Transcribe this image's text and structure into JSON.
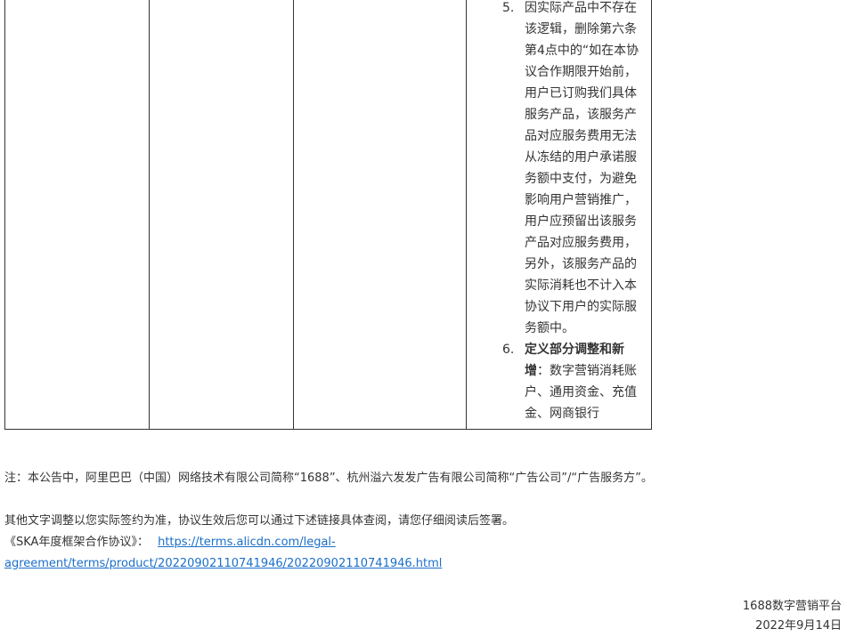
{
  "changes": [
    {
      "number": "5.",
      "bold": "",
      "text": "因实际产品中不存在该逻辑，删除第六条第4点中的“如在本协议合作期限开始前，用户已订购我们具体服务产品，该服务产品对应服务费用无法从冻结的用户承诺服务额中支付，为避免影响用户营销推广，用户应预留出该服务产品对应服务费用，另外，该服务产品的实际消耗也不计入本协议下用户的实际服务额中。"
    },
    {
      "number": "6.",
      "bold": "定义部分调整和新增",
      "text": "：数字营销消耗账户、通用资金、充值金、网商银行"
    }
  ],
  "note": "注：本公告中，阿里巴巴（中国）网络技术有限公司简称“1688”、杭州溢六发发广告有限公司简称“广告公司”/“广告服务方”。",
  "other_text": "其他文字调整以您实际签约为准，协议生效后您可以通过下述链接具体查阅，请您仔细阅读后签署。",
  "agreement_label": "《SKA年度框架合作协议》：",
  "agreement_link_line1": "https://terms.alicdn.com/legal-",
  "agreement_link_line2": "agreement/terms/product/20220902110741946/20220902110741946.html",
  "signature_org": "1688数字营销平台",
  "signature_date": "2022年9月14日"
}
